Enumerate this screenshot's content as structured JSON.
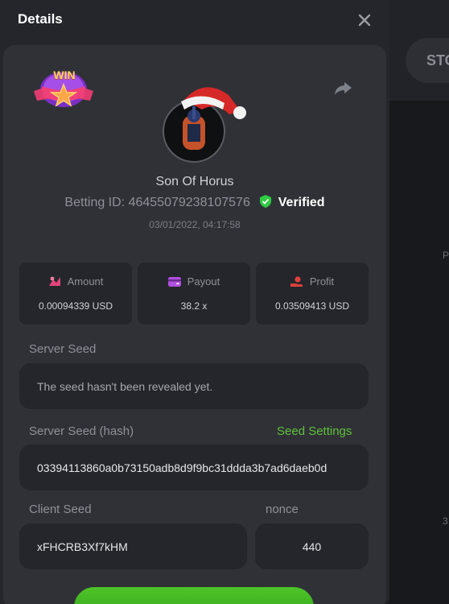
{
  "background": {
    "stop_button_label": "STO",
    "fragments": [
      "P",
      "3"
    ]
  },
  "modal": {
    "title": "Details",
    "close_icon": "close-icon",
    "win_badge_text": "WIN",
    "share_icon": "share-icon",
    "username": "Son Of Horus",
    "betting_id_label": "Betting ID:",
    "betting_id": "46455079238107576",
    "verified_label": "Verified",
    "datetime": "03/01/2022, 04:17:58",
    "stats": [
      {
        "label": "Amount",
        "value": "0.00094339 USD",
        "icon": "amount-icon"
      },
      {
        "label": "Payout",
        "value": "38.2 x",
        "icon": "wallet-icon"
      },
      {
        "label": "Profit",
        "value": "0.03509413 USD",
        "icon": "profit-icon"
      }
    ],
    "server_seed_label": "Server Seed",
    "server_seed_value": "The seed hasn't been revealed yet.",
    "server_seed_hash_label": "Server Seed (hash)",
    "seed_settings_link": "Seed Settings",
    "server_seed_hash_value": "03394113860a0b73150adb8d9f9bc31ddda3b7ad6daeb0d",
    "client_seed_label": "Client Seed",
    "client_seed_value": "xFHCRB3Xf7kHM",
    "nonce_label": "nonce",
    "nonce_value": "440"
  },
  "colors": {
    "accent_green": "#5ec23a",
    "verified_shield": "#2ecc40",
    "amount_icon": "#e0457b",
    "payout_icon": "#b04fe0",
    "profit_icon": "#e0403c"
  }
}
